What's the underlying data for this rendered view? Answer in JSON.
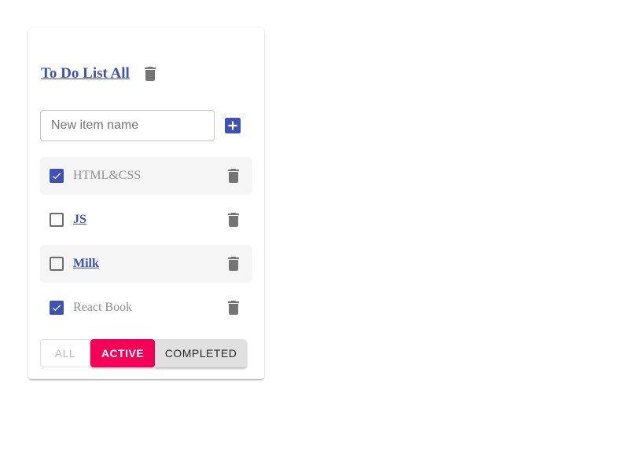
{
  "header": {
    "title": "To Do List All"
  },
  "new_item": {
    "placeholder": "New item name",
    "value": ""
  },
  "items": [
    {
      "label": "HTML&CSS",
      "checked": true,
      "shaded": true
    },
    {
      "label": "JS",
      "checked": false,
      "shaded": false
    },
    {
      "label": "Milk",
      "checked": false,
      "shaded": true
    },
    {
      "label": "React Book",
      "checked": true,
      "shaded": false
    }
  ],
  "filters": {
    "all_label": "All",
    "active_label": "Active",
    "completed_label": "Completed",
    "selected": "Active"
  },
  "colors": {
    "primary": "#3f51b5",
    "secondary": "#f50057",
    "icon_gray": "#757575"
  },
  "icons": {
    "delete": "trash-icon",
    "add": "add-box-icon",
    "check": "check-icon"
  }
}
